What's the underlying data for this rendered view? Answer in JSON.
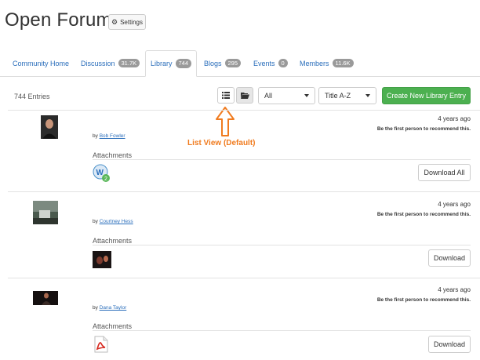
{
  "header": {
    "title": "Open Forum",
    "settings_label": "Settings"
  },
  "tabs": [
    {
      "label": "Community Home",
      "badge": ""
    },
    {
      "label": "Discussion",
      "badge": "31.7K"
    },
    {
      "label": "Library",
      "badge": "744"
    },
    {
      "label": "Blogs",
      "badge": "295"
    },
    {
      "label": "Events",
      "badge": "0"
    },
    {
      "label": "Members",
      "badge": "11.6K"
    }
  ],
  "toolbar": {
    "entries": "744 Entries",
    "filter_value": "All",
    "sort_value": "Title A-Z",
    "create_label": "Create New Library Entry"
  },
  "annotation": {
    "text": "List View (Default)",
    "color": "#f07b1f"
  },
  "entries": [
    {
      "by": "by",
      "author": "Bob Fowler",
      "ago": "4 years ago",
      "recommend": "Be the first person to recommend this.",
      "attachments_label": "Attachments",
      "download_label": "Download All",
      "attachment_icon": "word-document-icon"
    },
    {
      "by": "by",
      "author": "Courtney Hess",
      "ago": "4 years ago",
      "recommend": "Be the first person to recommend this.",
      "attachments_label": "Attachments",
      "download_label": "Download",
      "attachment_icon": "video-thumbnail-icon"
    },
    {
      "by": "by",
      "author": "Dana Taylor",
      "ago": "4 years ago",
      "recommend": "Be the first person to recommend this.",
      "attachments_label": "Attachments",
      "download_label": "Download",
      "attachment_icon": "pdf-icon"
    }
  ],
  "colors": {
    "accent": "#2a6ebb",
    "create_button": "#4cb050",
    "badge": "#9a9a9a"
  }
}
